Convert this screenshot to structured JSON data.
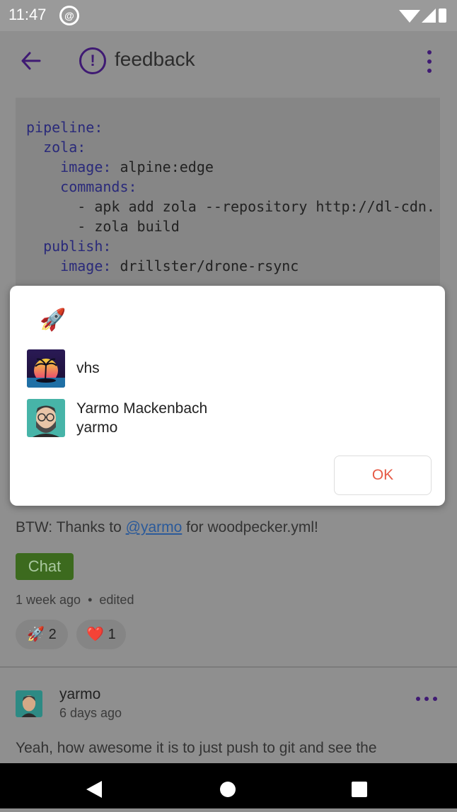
{
  "status": {
    "time": "11:47",
    "notification_icon": "at-sign-icon"
  },
  "header": {
    "title": "feedback",
    "back_icon": "arrow-left-icon",
    "menu_icon": "kebab-icon"
  },
  "code": {
    "lines": [
      "pipeline:",
      "  zola:",
      "    image: alpine:edge",
      "    commands:",
      "      - apk add zola --repository http://dl-cdn.",
      "      - zola build",
      "  publish:",
      "    image: drillster/drone-rsync"
    ]
  },
  "dialog": {
    "emoji": "🚀",
    "users": [
      {
        "name": "vhs",
        "username": ""
      },
      {
        "name": "Yarmo Mackenbach",
        "username": "yarmo"
      }
    ],
    "ok_label": "OK"
  },
  "post": {
    "text_before": "BTW: Thanks to ",
    "mention": "@yarmo",
    "text_after": " for woodpecker.yml!",
    "tag": "Chat",
    "time": "1 week ago",
    "edited": "edited",
    "reactions": [
      {
        "emoji": "🚀",
        "count": "2"
      },
      {
        "emoji": "❤️",
        "count": "1"
      }
    ]
  },
  "comment": {
    "username": "yarmo",
    "time": "6 days ago",
    "body": "Yeah, how awesome it is to just push to git and see the"
  },
  "colors": {
    "accent": "#3f1a73",
    "ok": "#e65a46",
    "chat_tag": "#3c6a1e"
  }
}
